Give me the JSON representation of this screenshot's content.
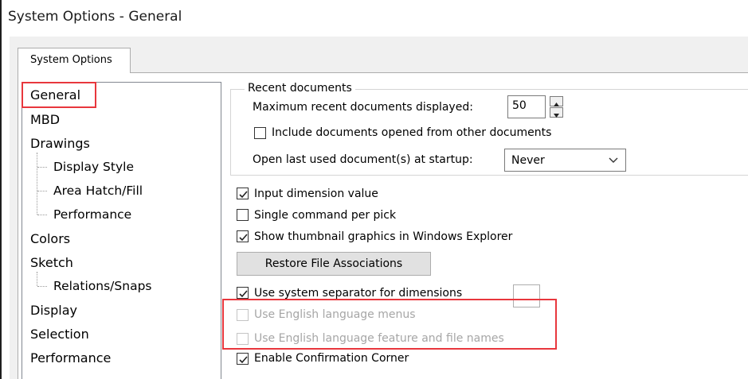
{
  "window": {
    "title": "System Options - General"
  },
  "tabs": [
    {
      "label": "System Options"
    }
  ],
  "tree": {
    "items": [
      {
        "label": "General",
        "selected": true
      },
      {
        "label": "MBD"
      },
      {
        "label": "Drawings"
      },
      {
        "label": "Display Style"
      },
      {
        "label": "Area Hatch/Fill"
      },
      {
        "label": "Performance"
      },
      {
        "label": "Colors"
      },
      {
        "label": "Sketch"
      },
      {
        "label": "Relations/Snaps"
      },
      {
        "label": "Display"
      },
      {
        "label": "Selection"
      },
      {
        "label": "Performance"
      }
    ]
  },
  "recent_documents": {
    "group_label": "Recent documents",
    "max_label": "Maximum recent documents displayed:",
    "max_value": "50",
    "include_label": "Include documents opened from other documents",
    "include_checked": false,
    "open_last_label": "Open last used document(s) at startup:",
    "open_last_value": "Never"
  },
  "options": {
    "input_dimension": {
      "label": "Input dimension value",
      "checked": true
    },
    "single_command": {
      "label": "Single command per pick",
      "checked": false
    },
    "show_thumbnail": {
      "label": "Show thumbnail graphics in Windows Explorer",
      "checked": true
    },
    "restore_button": "Restore File Associations",
    "system_separator": {
      "label": "Use system separator for dimensions",
      "checked": true
    },
    "english_menus": {
      "label": "Use English language menus",
      "checked": false,
      "disabled": true
    },
    "english_features": {
      "label": "Use English language feature and file names",
      "checked": false,
      "disabled": true
    },
    "confirmation_corner": {
      "label": "Enable Confirmation Corner",
      "checked": true
    }
  },
  "colors": {
    "highlight": "#e8373d",
    "panel_bg": "#f0f0f0",
    "disabled_text": "#a6a6a6"
  }
}
